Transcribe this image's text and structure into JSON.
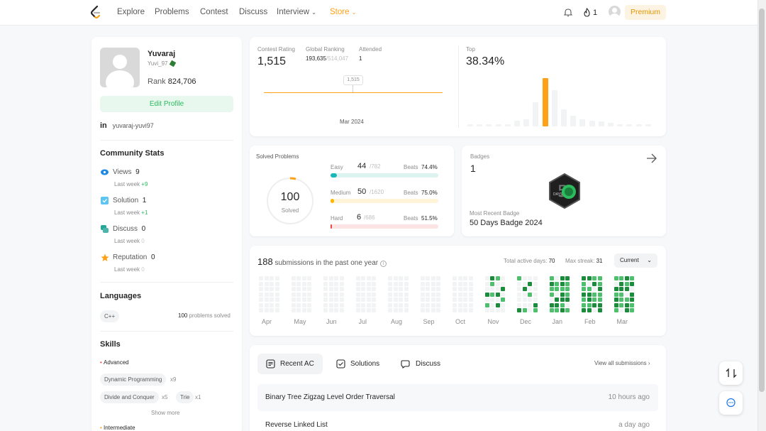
{
  "nav": {
    "items": [
      "Explore",
      "Problems",
      "Contest",
      "Discuss",
      "Interview",
      "Store"
    ],
    "streak": "1",
    "premium": "Premium"
  },
  "profile": {
    "name": "Yuvaraj",
    "username": "Yuvi_97",
    "rank_label": "Rank",
    "rank": "824,706",
    "edit": "Edit Profile",
    "linkedin": "yuvaraj-yuvi97"
  },
  "community": {
    "title": "Community Stats",
    "items": [
      {
        "label": "Views",
        "value": "9",
        "lw": "Last week",
        "delta": "+9",
        "color": "#1e88e5"
      },
      {
        "label": "Solution",
        "value": "1",
        "lw": "Last week",
        "delta": "+1",
        "color": "#29b6f6"
      },
      {
        "label": "Discuss",
        "value": "0",
        "lw": "Last week",
        "delta": "0",
        "color": "#26a69a"
      },
      {
        "label": "Reputation",
        "value": "0",
        "lw": "Last week",
        "delta": "0",
        "color": "#ffa116"
      }
    ]
  },
  "languages": {
    "title": "Languages",
    "lang": "C++",
    "solved": "100",
    "suffix": "problems solved"
  },
  "skills": {
    "title": "Skills",
    "advanced": "Advanced",
    "tags": [
      {
        "name": "Dynamic Programming",
        "count": "x9"
      },
      {
        "name": "Divide and Conquer",
        "count": "x5"
      },
      {
        "name": "Trie",
        "count": "x1"
      }
    ],
    "show_more": "Show more",
    "intermediate": "Intermediate"
  },
  "contest": {
    "rating_label": "Contest Rating",
    "rating": "1,515",
    "global_label": "Global Ranking",
    "global": "193,635",
    "global_total": "/514,047",
    "attended_label": "Attended",
    "attended": "1",
    "tooltip": "1,515",
    "date": "Mar 2024",
    "top_label": "Top",
    "top": "38.34%",
    "histogram": [
      1,
      1,
      1,
      2,
      2,
      5,
      6,
      20,
      40,
      30,
      14,
      9,
      6,
      5,
      4,
      3,
      2,
      1,
      1,
      1
    ]
  },
  "solved": {
    "title": "Solved Problems",
    "total": "100",
    "sub": "Solved",
    "beats_label": "Beats",
    "rows": [
      {
        "label": "Easy",
        "n": "44",
        "of": "/782",
        "beats": "74.4%",
        "fill": 0.056,
        "color": "#1cb8b8",
        "track": "#dcf3ef"
      },
      {
        "label": "Medium",
        "n": "50",
        "of": "/1620",
        "beats": "75.0%",
        "fill": 0.031,
        "color": "#ffb700",
        "track": "#fff4d8"
      },
      {
        "label": "Hard",
        "n": "6",
        "of": "/686",
        "beats": "51.5%",
        "fill": 0.009,
        "color": "#ef4743",
        "track": "#fde4e4"
      }
    ]
  },
  "badges": {
    "label": "Badges",
    "count": "1",
    "recent_label": "Most Recent Badge",
    "recent": "50 Days Badge 2024",
    "badge_text": "DAYS"
  },
  "submissions": {
    "count": "188",
    "text": "submissions in the past one year",
    "active_label": "Total active days:",
    "active": "70",
    "streak_label": "Max streak:",
    "streak": "31",
    "select": "Current",
    "months": [
      "Apr",
      "May",
      "Jun",
      "Jul",
      "Aug",
      "Sep",
      "Oct",
      "Nov",
      "Dec",
      "Jan",
      "Feb",
      "Mar"
    ]
  },
  "tabs": {
    "recent": "Recent AC",
    "solutions": "Solutions",
    "discuss": "Discuss",
    "view_all": "View all submissions"
  },
  "recent_list": [
    {
      "title": "Binary Tree Zigzag Level Order Traversal",
      "time": "10 hours ago"
    },
    {
      "title": "Reverse Linked List",
      "time": "a day ago"
    }
  ],
  "colors": {
    "accent": "#ffa116",
    "green": "#2cbb5d",
    "brand_dark": "#262626"
  }
}
